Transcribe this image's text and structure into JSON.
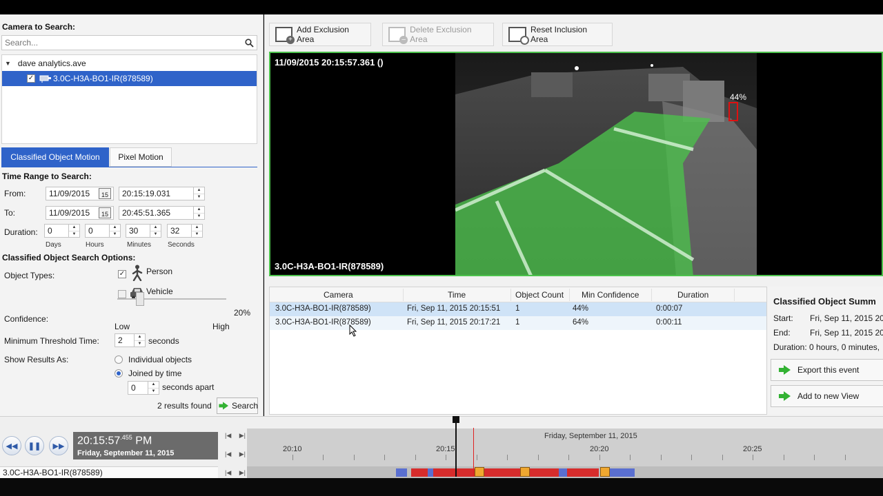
{
  "left": {
    "camera_search_label": "Camera to Search:",
    "search_placeholder": "Search...",
    "tree_root": "dave analytics.ave",
    "tree_camera": "3.0C-H3A-BO1-IR(878589)",
    "tabs": [
      "Classified Object Motion",
      "Pixel Motion"
    ],
    "time_range_label": "Time Range to Search:",
    "from_label": "From:",
    "to_label": "To:",
    "from_date": "11/09/2015",
    "from_time": "20:15:19.031",
    "to_date": "11/09/2015",
    "to_time": "20:45:51.365",
    "cal_num": "15",
    "duration_label": "Duration:",
    "duration": {
      "days": "0",
      "hours": "0",
      "minutes": "30",
      "seconds": "32"
    },
    "duration_units": {
      "days": "Days",
      "hours": "Hours",
      "minutes": "Minutes",
      "seconds": "Seconds"
    },
    "options_label": "Classified Object Search Options:",
    "object_types_label": "Object Types:",
    "person_label": "Person",
    "person_checked": true,
    "vehicle_label": "Vehicle",
    "vehicle_checked": false,
    "confidence_label": "Confidence:",
    "confidence_value": "20%",
    "confidence_low": "Low",
    "confidence_high": "High",
    "min_threshold_label": "Minimum Threshold Time:",
    "min_threshold_value": "2",
    "seconds_label": "seconds",
    "show_results_label": "Show Results As:",
    "individual_label": "Individual objects",
    "joined_label": "Joined by time",
    "apart_value": "0",
    "apart_label": "seconds apart",
    "results_found": "2 results found",
    "search_button": "Search"
  },
  "toolbar": {
    "add_exclusion": "Add Exclusion Area",
    "delete_exclusion": "Delete Exclusion Area",
    "reset_inclusion": "Reset Inclusion Area"
  },
  "video": {
    "timestamp": "11/09/2015 20:15:57.361 ()",
    "camera": "3.0C-H3A-BO1-IR(878589)",
    "detection_confidence": "44%"
  },
  "results": {
    "columns": [
      "Camera",
      "Time",
      "Object Count",
      "Min Confidence",
      "Duration"
    ],
    "rows": [
      {
        "camera": "3.0C-H3A-BO1-IR(878589)",
        "time": "Fri, Sep 11, 2015 20:15:51",
        "count": "1",
        "confidence": "44%",
        "duration": "0:00:07"
      },
      {
        "camera": "3.0C-H3A-BO1-IR(878589)",
        "time": "Fri, Sep 11, 2015 20:17:21",
        "count": "1",
        "confidence": "64%",
        "duration": "0:00:11"
      }
    ]
  },
  "summary": {
    "title": "Classified Object Summ",
    "start_label": "Start:",
    "start_value": "Fri, Sep 11, 2015 20:",
    "end_label": "End:",
    "end_value": "Fri, Sep 11, 2015 20:",
    "duration_text": "Duration: 0 hours, 0 minutes,",
    "export_button": "Export this event",
    "add_view_button": "Add to new View"
  },
  "playback": {
    "time_main": "20:15:57",
    "time_ms": ".455",
    "time_ampm": "PM",
    "date": "Friday, September 11, 2015",
    "camera": "3.0C-H3A-BO1-IR(878589)",
    "timeline_date": "Friday, September 11, 2015",
    "ticks": [
      "20:10",
      "20:15",
      "20:20",
      "20:25"
    ]
  },
  "colors": {
    "accent": "#2f63c9",
    "inclusion_area": "#4cc24c",
    "motion": "#d62c2c"
  }
}
